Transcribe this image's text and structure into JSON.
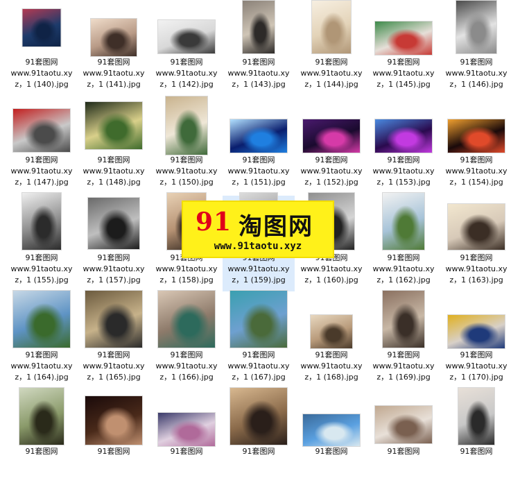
{
  "items": [
    {
      "l1": "91套图网",
      "l2": "www.91taotu.xy",
      "l3": "z，1 (140).jpg",
      "c": [
        "#1d3b6b",
        "#0f2346",
        "#b43a52"
      ]
    },
    {
      "l1": "91套图网",
      "l2": "www.91taotu.xy",
      "l3": "z，1 (141).jpg",
      "c": [
        "#b89a86",
        "#3f2f28",
        "#efdcca"
      ]
    },
    {
      "l1": "91套图网",
      "l2": "www.91taotu.xy",
      "l3": "z，1 (142).jpg",
      "c": [
        "#d8d8d8",
        "#3a3a3a",
        "#f2f2f2"
      ]
    },
    {
      "l1": "91套图网",
      "l2": "www.91taotu.xy",
      "l3": "z，1 (143).jpg",
      "c": [
        "#cfc5b6",
        "#2d2a28",
        "#8a8178"
      ]
    },
    {
      "l1": "91套图网",
      "l2": "www.91taotu.xy",
      "l3": "z，1 (144).jpg",
      "c": [
        "#e3d3b8",
        "#b09676",
        "#f7efe1"
      ]
    },
    {
      "l1": "91套图网",
      "l2": "www.91taotu.xy",
      "l3": "z，1 (145).jpg",
      "c": [
        "#e6dfd8",
        "#c73a35",
        "#3d8a4a"
      ]
    },
    {
      "l1": "91套图网",
      "l2": "www.91taotu.xy",
      "l3": "z，1 (146).jpg",
      "c": [
        "#e3e3e3",
        "#8b8b8b",
        "#4a4a4a"
      ]
    },
    {
      "l1": "91套图网",
      "l2": "www.91taotu.xy",
      "l3": "z，1 (147).jpg",
      "c": [
        "#c9c9c9",
        "#4b4b4b",
        "#c21f1f"
      ]
    },
    {
      "l1": "91套图网",
      "l2": "www.91taotu.xy",
      "l3": "z，1 (148).jpg",
      "c": [
        "#d9d08a",
        "#3f6b2c",
        "#1f2a1a"
      ]
    },
    {
      "l1": "91套图网",
      "l2": "www.91taotu.xy",
      "l3": "z，1 (150).jpg",
      "c": [
        "#efe7d7",
        "#3f6a3a",
        "#c9b38e"
      ]
    },
    {
      "l1": "91套图网",
      "l2": "www.91taotu.xy",
      "l3": "z，1 (151).jpg",
      "c": [
        "#0a1e6e",
        "#1f7fe0",
        "#b2e0ff"
      ]
    },
    {
      "l1": "91套图网",
      "l2": "www.91taotu.xy",
      "l3": "z，1 (152).jpg",
      "c": [
        "#1a0a2e",
        "#d63aa8",
        "#4a1a6e"
      ]
    },
    {
      "l1": "91套图网",
      "l2": "www.91taotu.xy",
      "l3": "z，1 (153).jpg",
      "c": [
        "#2a0a4e",
        "#c23ae0",
        "#4a8ae0"
      ]
    },
    {
      "l1": "91套图网",
      "l2": "www.91taotu.xy",
      "l3": "z，1 (154).jpg",
      "c": [
        "#1a0a0a",
        "#e04a2a",
        "#f0a030"
      ]
    },
    {
      "l1": "91套图网",
      "l2": "www.91taotu.xy",
      "l3": "z，1 (155).jpg",
      "c": [
        "#8e8e8e",
        "#2b2b2b",
        "#f0f0f0"
      ]
    },
    {
      "l1": "91套图网",
      "l2": "www.91taotu.xy",
      "l3": "z，1 (157).jpg",
      "c": [
        "#bfbfbf",
        "#1c1c1c",
        "#6a6a6a"
      ]
    },
    {
      "l1": "91套图网",
      "l2": "www.91taotu.xy",
      "l3": "z，1 (158).jpg",
      "c": [
        "#b69273",
        "#2e241d",
        "#e8d1b5"
      ]
    },
    {
      "l1": "91套图网",
      "l2": "www.91taotu.xy",
      "l3": "z，1 (159).jpg",
      "c": [
        "#9b9b9b",
        "#2f2f2f",
        "#dcdcdc"
      ]
    },
    {
      "l1": "91套图网",
      "l2": "www.91taotu.xy",
      "l3": "z，1 (160).jpg",
      "c": [
        "#d5d5d5",
        "#222222",
        "#8f8f8f"
      ]
    },
    {
      "l1": "91套图网",
      "l2": "www.91taotu.xy",
      "l3": "z，1 (162).jpg",
      "c": [
        "#a7c3d8",
        "#4f7a36",
        "#f2f2f2"
      ]
    },
    {
      "l1": "91套图网",
      "l2": "www.91taotu.xy",
      "l3": "z，1 (163).jpg",
      "c": [
        "#d7c9b8",
        "#3b2e25",
        "#f2e7cf"
      ]
    },
    {
      "l1": "91套图网",
      "l2": "www.91taotu.xy",
      "l3": "z，1 (164).jpg",
      "c": [
        "#5e93c4",
        "#3a6a2c",
        "#c7d8e6"
      ]
    },
    {
      "l1": "91套图网",
      "l2": "www.91taotu.xy",
      "l3": "z，1 (165).jpg",
      "c": [
        "#c7b28a",
        "#2a2a2a",
        "#6b5a3e"
      ]
    },
    {
      "l1": "91套图网",
      "l2": "www.91taotu.xy",
      "l3": "z，1 (166).jpg",
      "c": [
        "#8d7a6a",
        "#2d6a5c",
        "#d9c7b5"
      ]
    },
    {
      "l1": "91套图网",
      "l2": "www.91taotu.xy",
      "l3": "z，1 (167).jpg",
      "c": [
        "#6ea0d0",
        "#4a6a3a",
        "#3aa0b0"
      ]
    },
    {
      "l1": "91套图网",
      "l2": "www.91taotu.xy",
      "l3": "z，1 (168).jpg",
      "c": [
        "#b89a7a",
        "#4a3a2a",
        "#e8d8c0"
      ]
    },
    {
      "l1": "91套图网",
      "l2": "www.91taotu.xy",
      "l3": "z，1 (169).jpg",
      "c": [
        "#c8b8a6",
        "#3a2f28",
        "#8a7060"
      ]
    },
    {
      "l1": "91套图网",
      "l2": "www.91taotu.xy",
      "l3": "z，1 (170).jpg",
      "c": [
        "#d8d0c8",
        "#1f3a7a",
        "#e0b020"
      ]
    },
    {
      "l1": "91套图网",
      "l2": "",
      "l3": "",
      "c": [
        "#8a9a6a",
        "#2a2a1a",
        "#d0d8c0"
      ]
    },
    {
      "l1": "91套图网",
      "l2": "",
      "l3": "",
      "c": [
        "#4a2a1a",
        "#c09070",
        "#1a0a0a"
      ]
    },
    {
      "l1": "91套图网",
      "l2": "",
      "l3": "",
      "c": [
        "#e0d0e0",
        "#b06a9a",
        "#3a3a6a"
      ]
    },
    {
      "l1": "91套图网",
      "l2": "",
      "l3": "",
      "c": [
        "#8a6a4a",
        "#2a1f1a",
        "#d8b890"
      ]
    },
    {
      "l1": "91套图网",
      "l2": "",
      "l3": "",
      "c": [
        "#5aa0e0",
        "#d8e8f0",
        "#3a6a9a"
      ]
    },
    {
      "l1": "91套图网",
      "l2": "",
      "l3": "",
      "c": [
        "#e8e0d8",
        "#7a6050",
        "#c0a890"
      ]
    },
    {
      "l1": "91套图网",
      "l2": "",
      "l3": "",
      "c": [
        "#c8c8c8",
        "#2a2a2a",
        "#e8e0d8"
      ]
    }
  ],
  "watermark": {
    "num": "91",
    "cn": "淘图网",
    "url": "www.91taotu.xyz"
  },
  "selected_index": 17
}
